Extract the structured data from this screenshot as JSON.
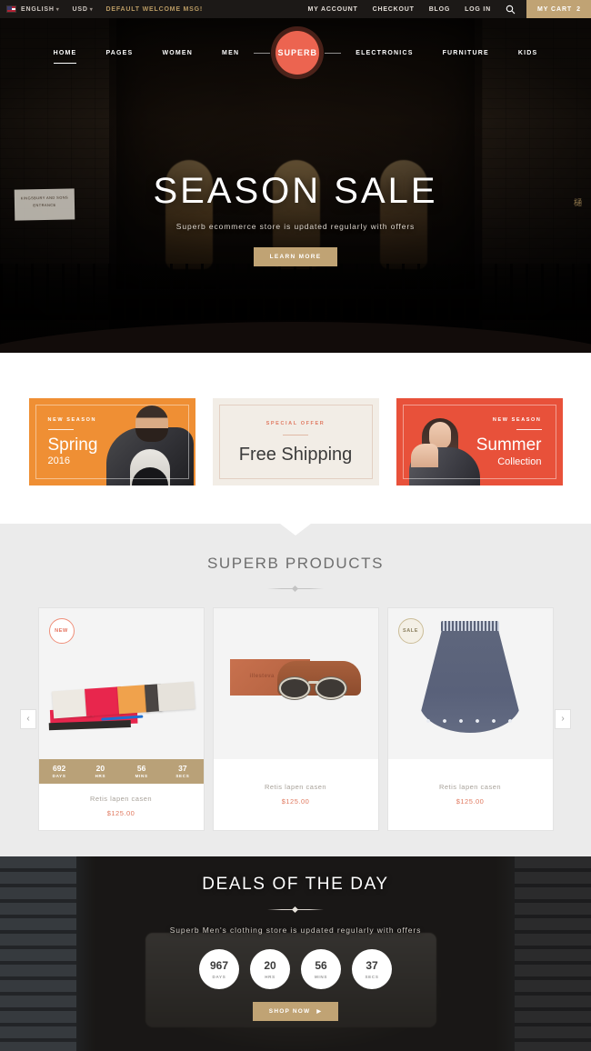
{
  "topbar": {
    "flag_icon": "us-flag-icon",
    "language": "ENGLISH",
    "currency": "USD",
    "caret": "▾",
    "welcome_msg": "DEFAULT WELCOME MSG!",
    "links": [
      "MY ACCOUNT",
      "CHECKOUT",
      "BLOG",
      "LOG IN"
    ],
    "search_icon": "search-icon",
    "cart_label": "MY CART",
    "cart_count": "2",
    "cart_bg": "#c0a374"
  },
  "nav": {
    "left_items": [
      "HOME",
      "PAGES",
      "WOMEN",
      "MEN"
    ],
    "right_items": [
      "ELECTRONICS",
      "FURNITURE",
      "KIDS"
    ],
    "active": "HOME",
    "logo": "SUPERB",
    "logo_color": "#ec6450"
  },
  "hero": {
    "title": "SEASON SALE",
    "subtitle": "Superb ecommerce store is updated regularly with offers",
    "cta": "LEARN MORE",
    "cta_bg": "#c0a374",
    "sign_text": "KINGSBURY AND SONS",
    "sign_sub": "ENTRANCE",
    "glyph": "樋"
  },
  "promos": [
    {
      "kicker": "NEW SEASON",
      "main": "Spring",
      "secondary": "2016",
      "bg": "#ef8f34"
    },
    {
      "kicker": "SPECIAL OFFER",
      "main": "Free Shipping",
      "secondary": "",
      "bg": "#f2ede6"
    },
    {
      "kicker": "NEW SEASON",
      "main": "Summer",
      "secondary": "Collection",
      "bg": "#e8513a"
    }
  ],
  "products_section": {
    "title": "SUPERB PRODUCTS",
    "prev_icon": "chevron-left-icon",
    "next_icon": "chevron-right-icon",
    "prev_glyph": "‹",
    "next_glyph": "›",
    "items": [
      {
        "badge": "NEW",
        "name": "Retis lapen casen",
        "price": "$125.00",
        "timer": [
          {
            "num": "692",
            "label": "DAYS"
          },
          {
            "num": "20",
            "label": "HRS"
          },
          {
            "num": "56",
            "label": "MINS"
          },
          {
            "num": "37",
            "label": "SECS"
          }
        ]
      },
      {
        "badge": "",
        "name": "Retis lapen casen",
        "price": "$125.00",
        "timer": []
      },
      {
        "badge": "SALE",
        "name": "Retis lapen casen",
        "price": "$125.00",
        "timer": []
      }
    ]
  },
  "deals": {
    "title": "DEALS OF THE DAY",
    "subtitle": "Superb Men's clothing store is updated regularly with offers",
    "cta": "SHOP NOW",
    "cta_caret": "▶",
    "cta_bg": "#c0a374",
    "timer": [
      {
        "num": "967",
        "label": "DAYS"
      },
      {
        "num": "20",
        "label": "HRS"
      },
      {
        "num": "56",
        "label": "MINS"
      },
      {
        "num": "37",
        "label": "SECS"
      }
    ]
  }
}
